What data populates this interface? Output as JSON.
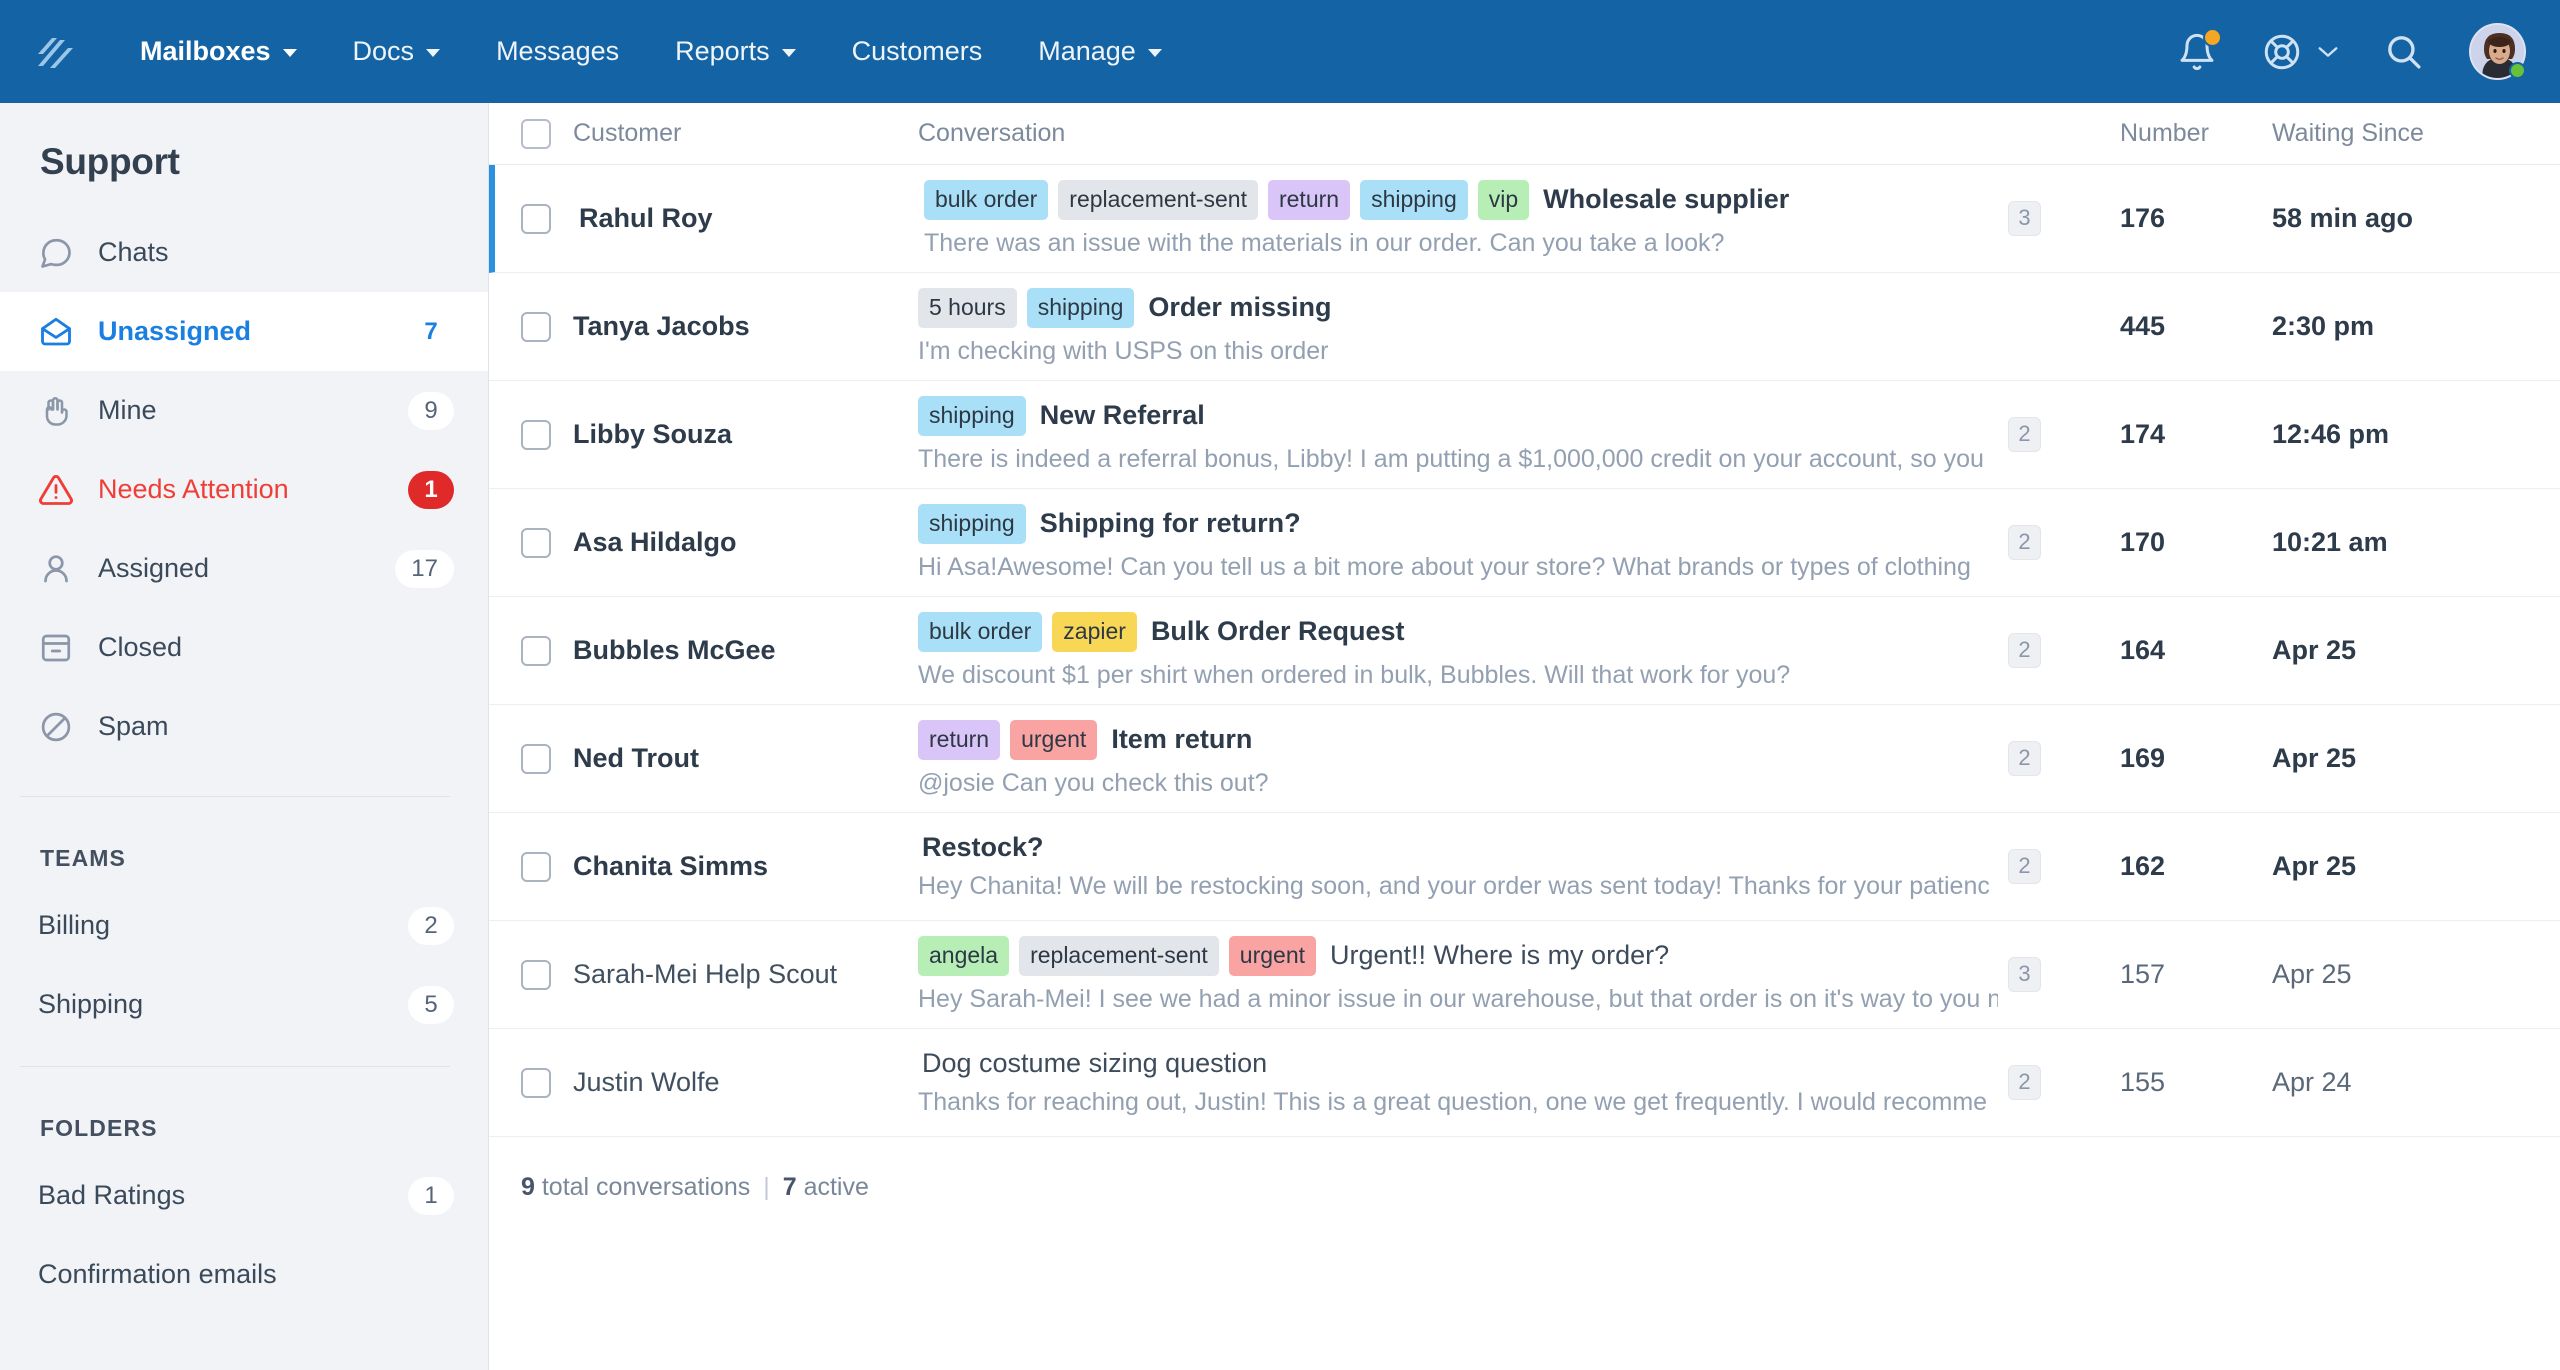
{
  "topnav": {
    "logo_name": "help-scout-logo",
    "items": [
      {
        "label": "Mailboxes",
        "has_caret": true,
        "active": true
      },
      {
        "label": "Docs",
        "has_caret": true,
        "active": false
      },
      {
        "label": "Messages",
        "has_caret": false,
        "active": false
      },
      {
        "label": "Reports",
        "has_caret": true,
        "active": false
      },
      {
        "label": "Customers",
        "has_caret": false,
        "active": false
      },
      {
        "label": "Manage",
        "has_caret": true,
        "active": false
      }
    ],
    "brand_color": "#1464a5",
    "notification_dot_color": "#f5a623",
    "online_dot_color": "#67c23a"
  },
  "sidebar": {
    "title": "Support",
    "items": [
      {
        "label": "Chats",
        "icon": "chat-bubble-icon",
        "count": "",
        "state": "normal"
      },
      {
        "label": "Unassigned",
        "icon": "open-envelope-icon",
        "count": "7",
        "state": "selected"
      },
      {
        "label": "Mine",
        "icon": "hand-icon",
        "count": "9",
        "state": "normal"
      },
      {
        "label": "Needs Attention",
        "icon": "warning-triangle-icon",
        "count": "1",
        "state": "alert"
      },
      {
        "label": "Assigned",
        "icon": "person-icon",
        "count": "17",
        "state": "normal"
      },
      {
        "label": "Closed",
        "icon": "archive-icon",
        "count": "",
        "state": "normal"
      },
      {
        "label": "Spam",
        "icon": "no-entry-icon",
        "count": "",
        "state": "normal"
      }
    ],
    "teams_heading": "TEAMS",
    "teams": [
      {
        "label": "Billing",
        "count": "2"
      },
      {
        "label": "Shipping",
        "count": "5"
      }
    ],
    "folders_heading": "FOLDERS",
    "folders": [
      {
        "label": "Bad Ratings",
        "count": "1"
      },
      {
        "label": "Confirmation emails",
        "count": ""
      }
    ],
    "selected_color": "#1a7fe0",
    "alert_color": "#ef3e36"
  },
  "table": {
    "headers": {
      "customer": "Customer",
      "conversation": "Conversation",
      "number": "Number",
      "waiting": "Waiting Since"
    },
    "rows": [
      {
        "customer": "Rahul Roy",
        "tags": [
          {
            "label": "bulk order",
            "color": "#a9e0f7"
          },
          {
            "label": "replacement-sent",
            "color": "#e2e5e9"
          },
          {
            "label": "return",
            "color": "#d9c5f7"
          },
          {
            "label": "shipping",
            "color": "#a9e0f7"
          },
          {
            "label": "vip",
            "color": "#b6eeb6"
          }
        ],
        "subject": "Wholesale supplier",
        "preview": "There was an issue with the materials in our order. Can you take a look?",
        "thread_count": "3",
        "number": "176",
        "waiting": "58 min ago",
        "read": false,
        "selected": true
      },
      {
        "customer": "Tanya Jacobs",
        "tags": [
          {
            "label": "5 hours",
            "color": "#e2e5e9"
          },
          {
            "label": "shipping",
            "color": "#a9e0f7"
          }
        ],
        "subject": "Order missing",
        "preview": "I'm checking with USPS on this order",
        "thread_count": "",
        "number": "445",
        "waiting": "2:30 pm",
        "read": false,
        "selected": false
      },
      {
        "customer": "Libby Souza",
        "tags": [
          {
            "label": "shipping",
            "color": "#a9e0f7"
          }
        ],
        "subject": "New Referral",
        "preview": "There is indeed a referral bonus, Libby! I am putting a $1,000,000 credit on your account, so you",
        "thread_count": "2",
        "number": "174",
        "waiting": "12:46 pm",
        "read": false,
        "selected": false
      },
      {
        "customer": "Asa Hildalgo",
        "tags": [
          {
            "label": "shipping",
            "color": "#a9e0f7"
          }
        ],
        "subject": "Shipping for return?",
        "preview": "Hi Asa!Awesome! Can you tell us a bit more about your store? What brands or types of clothing",
        "thread_count": "2",
        "number": "170",
        "waiting": "10:21 am",
        "read": false,
        "selected": false
      },
      {
        "customer": "Bubbles McGee",
        "tags": [
          {
            "label": "bulk order",
            "color": "#a9e0f7"
          },
          {
            "label": "zapier",
            "color": "#f7d755"
          }
        ],
        "subject": "Bulk Order Request",
        "preview": "We discount $1 per shirt when ordered in bulk, Bubbles. Will that work for you?",
        "thread_count": "2",
        "number": "164",
        "waiting": "Apr 25",
        "read": false,
        "selected": false
      },
      {
        "customer": "Ned Trout",
        "tags": [
          {
            "label": "return",
            "color": "#d9c5f7"
          },
          {
            "label": "urgent",
            "color": "#f9a3a3"
          }
        ],
        "subject": "Item return",
        "preview": "@josie Can  you check this out?",
        "thread_count": "2",
        "number": "169",
        "waiting": "Apr 25",
        "read": false,
        "selected": false
      },
      {
        "customer": "Chanita Simms",
        "tags": [],
        "subject": "Restock?",
        "preview": "Hey Chanita! We will be restocking soon, and your order was sent today! Thanks for your patienc",
        "thread_count": "2",
        "number": "162",
        "waiting": "Apr 25",
        "read": false,
        "selected": false
      },
      {
        "customer": "Sarah-Mei Help Scout",
        "tags": [
          {
            "label": "angela",
            "color": "#b6eeb6"
          },
          {
            "label": "replacement-sent",
            "color": "#e2e5e9"
          },
          {
            "label": "urgent",
            "color": "#f9a3a3"
          }
        ],
        "subject": "Urgent!! Where is my order?",
        "preview": "Hey Sarah-Mei! I see we had a minor issue in our warehouse, but that order is on it's way to you n",
        "thread_count": "3",
        "number": "157",
        "waiting": "Apr 25",
        "read": true,
        "selected": false
      },
      {
        "customer": "Justin Wolfe",
        "tags": [],
        "subject": "Dog costume sizing question",
        "preview": "Thanks for reaching out, Justin! This is a great question, one we get frequently. I would recomme",
        "thread_count": "2",
        "number": "155",
        "waiting": "Apr 24",
        "read": true,
        "selected": false
      }
    ],
    "footer": {
      "total_count": "9",
      "total_label": "total conversations",
      "separator": "|",
      "active_count": "7",
      "active_label": "active"
    }
  }
}
